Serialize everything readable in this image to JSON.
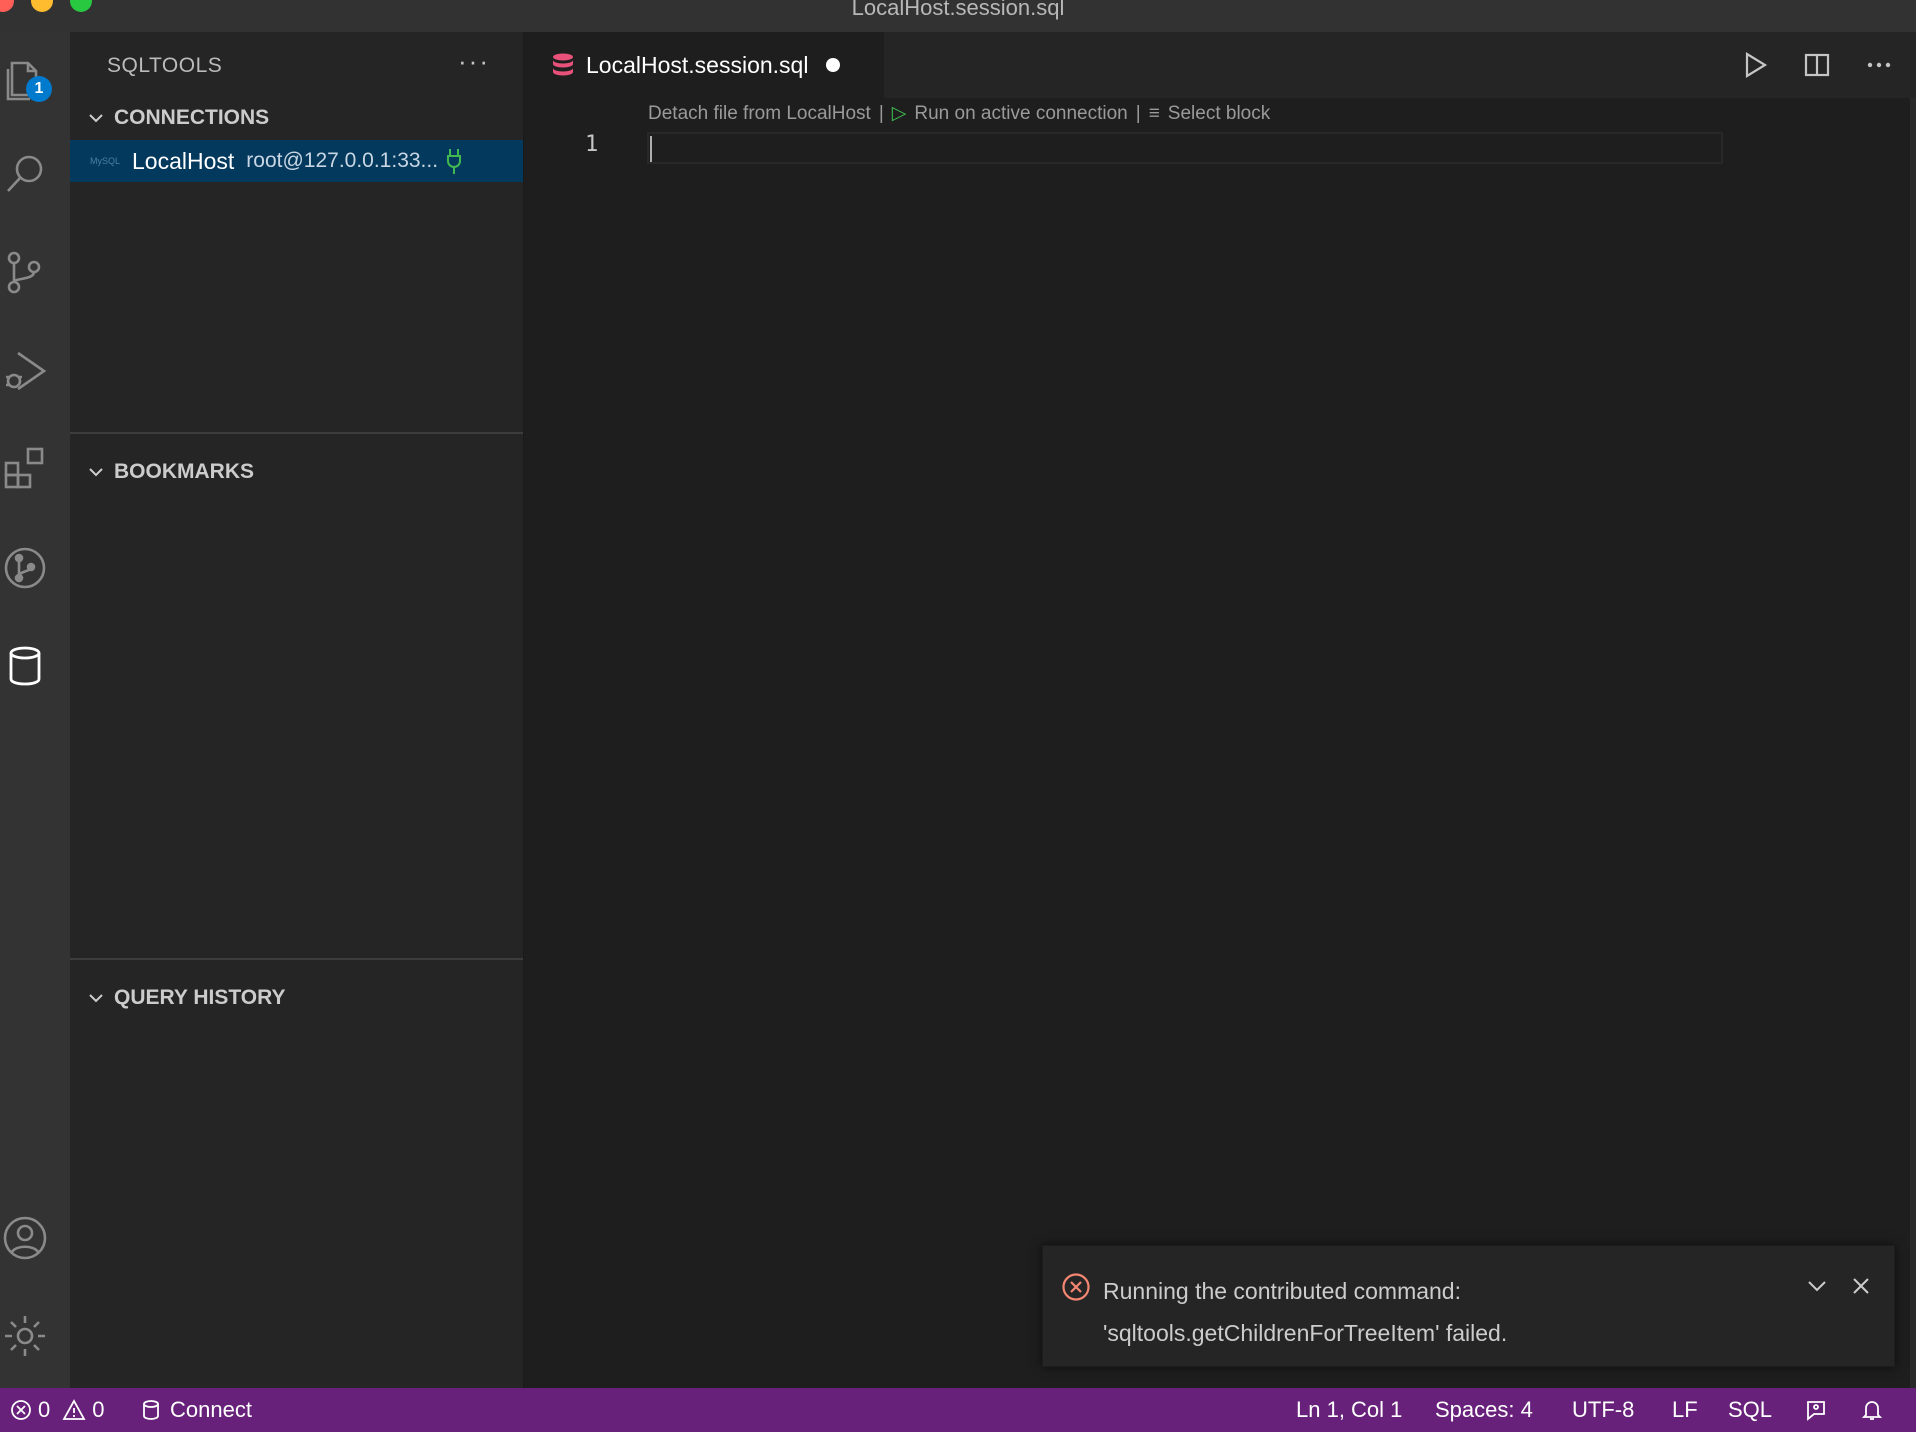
{
  "window": {
    "title": "LocalHost.session.sql"
  },
  "activity_bar": {
    "explorer_badge": "1"
  },
  "sidebar": {
    "title": "SQLTOOLS",
    "more": "···",
    "connections": {
      "header": "CONNECTIONS",
      "items": [
        {
          "logo": "MySQL",
          "name": "LocalHost",
          "description": "root@127.0.0.1:33..."
        }
      ]
    },
    "bookmarks": {
      "header": "BOOKMARKS"
    },
    "query_history": {
      "header": "QUERY HISTORY"
    }
  },
  "editor": {
    "tab": {
      "label": "LocalHost.session.sql"
    },
    "codelens": {
      "detach": "Detach file from LocalHost",
      "sep1": "|",
      "run": "Run on active connection",
      "sep2": "|",
      "select": "Select block"
    },
    "line_number": "1"
  },
  "notification": {
    "line1": "Running the contributed command:",
    "line2": "'sqltools.getChildrenForTreeItem' failed."
  },
  "status_bar": {
    "errors": "0",
    "warnings": "0",
    "connect": "Connect",
    "position": "Ln 1, Col 1",
    "spaces": "Spaces: 4",
    "encoding": "UTF-8",
    "eol": "LF",
    "language": "SQL"
  },
  "colors": {
    "status_bar": "#68217a",
    "selection": "#04395e",
    "badge": "#007acc",
    "error": "#f48771"
  }
}
